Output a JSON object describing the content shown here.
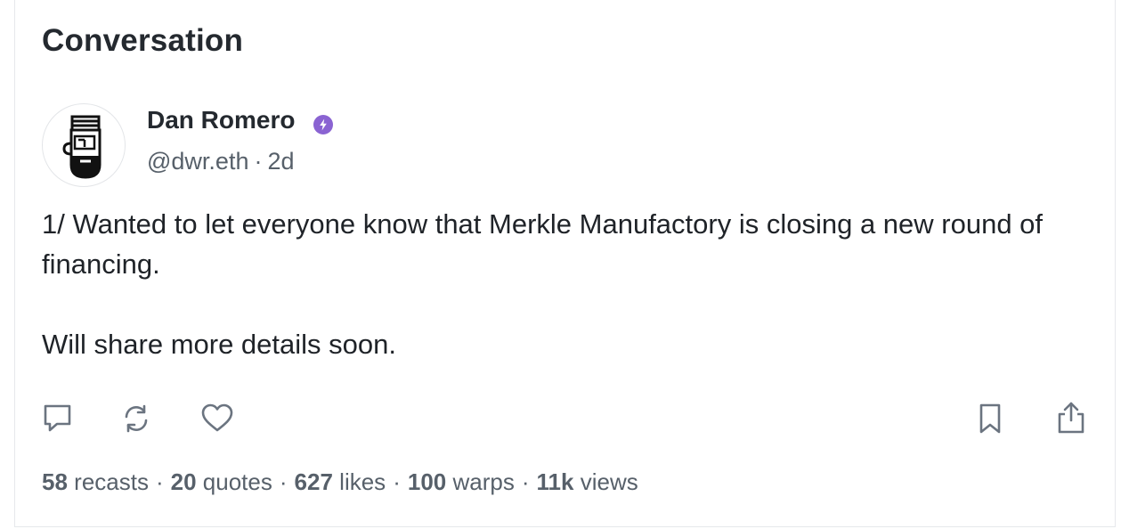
{
  "header": {
    "title": "Conversation"
  },
  "post": {
    "author": {
      "name": "Dan Romero",
      "handle": "@dwr.eth",
      "verified": true,
      "avatar_icon": "pirate-avatar-icon"
    },
    "time_ago": "2d",
    "meta_separator": "·",
    "body": [
      "1/ Wanted to let everyone know that Merkle Manufactory is closing a new round of financing.",
      "Will share more details soon."
    ],
    "actions": {
      "reply_icon": "comment-icon",
      "recast_icon": "recast-icon",
      "like_icon": "heart-icon",
      "bookmark_icon": "bookmark-icon",
      "share_icon": "share-icon"
    },
    "stats": [
      {
        "count": "58",
        "label": "recasts"
      },
      {
        "count": "20",
        "label": "quotes"
      },
      {
        "count": "627",
        "label": "likes"
      },
      {
        "count": "100",
        "label": "warps"
      },
      {
        "count": "11k",
        "label": "views"
      }
    ],
    "stats_separator": "·"
  },
  "colors": {
    "text_primary": "#24292f",
    "text_secondary": "#57606a",
    "icon": "#6b7480",
    "verified_badge": "#8a63d2",
    "border": "#e6e8eb"
  }
}
